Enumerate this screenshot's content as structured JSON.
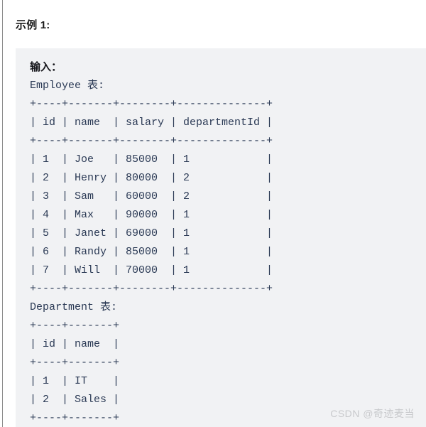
{
  "page": {
    "background": "#ffffff",
    "left_rule_color": "#8c8c8c"
  },
  "heading": {
    "text": "示例 1:"
  },
  "code_block": {
    "background": "#f1f2f4",
    "input_label": "输入：",
    "employee_table_label": "Employee 表:",
    "employee_lines": [
      "+----+-------+--------+--------------+",
      "| id | name  | salary | departmentId |",
      "+----+-------+--------+--------------+",
      "| 1  | Joe   | 85000  | 1            |",
      "| 2  | Henry | 80000  | 2            |",
      "| 3  | Sam   | 60000  | 2            |",
      "| 4  | Max   | 90000  | 1            |",
      "| 5  | Janet | 69000  | 1            |",
      "| 6  | Randy | 85000  | 1            |",
      "| 7  | Will  | 70000  | 1            |",
      "+----+-------+--------+--------------+"
    ],
    "department_table_label": "Department 表:",
    "department_lines": [
      "+----+-------+",
      "| id | name  |",
      "+----+-------+",
      "| 1  | IT    |",
      "| 2  | Sales |",
      "+----+-------+"
    ]
  },
  "chart_data": {
    "type": "table",
    "title": "示例 1 输入数据",
    "tables": [
      {
        "name": "Employee",
        "columns": [
          "id",
          "name",
          "salary",
          "departmentId"
        ],
        "rows": [
          [
            1,
            "Joe",
            85000,
            1
          ],
          [
            2,
            "Henry",
            80000,
            2
          ],
          [
            3,
            "Sam",
            60000,
            2
          ],
          [
            4,
            "Max",
            90000,
            1
          ],
          [
            5,
            "Janet",
            69000,
            1
          ],
          [
            6,
            "Randy",
            85000,
            1
          ],
          [
            7,
            "Will",
            70000,
            1
          ]
        ]
      },
      {
        "name": "Department",
        "columns": [
          "id",
          "name"
        ],
        "rows": [
          [
            1,
            "IT"
          ],
          [
            2,
            "Sales"
          ]
        ]
      }
    ]
  },
  "watermark": {
    "text": "CSDN @奇迹麦当"
  }
}
